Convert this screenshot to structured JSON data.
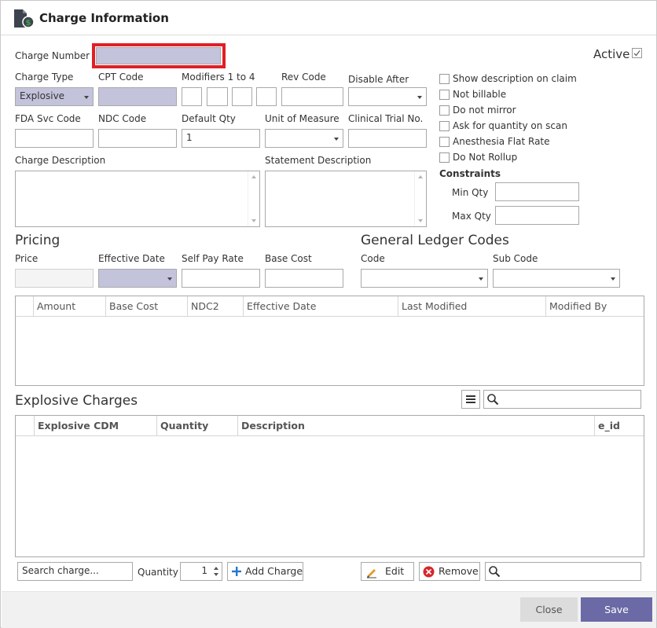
{
  "window": {
    "title": "Charge Information"
  },
  "header": {
    "charge_number_label": "Charge Number",
    "active_label": "Active"
  },
  "fields": {
    "charge_type_label": "Charge Type",
    "charge_type_value": "Explosive",
    "cpt_code_label": "CPT Code",
    "modifiers_label": "Modifiers 1 to 4",
    "rev_code_label": "Rev Code",
    "disable_after_label": "Disable After",
    "fda_svc_label": "FDA Svc Code",
    "ndc_code_label": "NDC Code",
    "default_qty_label": "Default Qty",
    "default_qty_value": "1",
    "uom_label": "Unit of Measure",
    "clinical_trial_label": "Clinical Trial No.",
    "charge_desc_label": "Charge Description",
    "statement_desc_label": "Statement Description"
  },
  "options": {
    "show_desc": "Show description on claim",
    "not_billable": "Not billable",
    "do_not_mirror": "Do not mirror",
    "ask_qty": "Ask for quantity on scan",
    "anesthesia": "Anesthesia Flat Rate",
    "do_not_rollup": "Do Not Rollup",
    "constraints": "Constraints",
    "min_qty": "Min Qty",
    "max_qty": "Max Qty"
  },
  "pricing": {
    "title": "Pricing",
    "price_label": "Price",
    "effective_date_label": "Effective Date",
    "self_pay_label": "Self Pay Rate",
    "base_cost_label": "Base Cost"
  },
  "gl": {
    "title": "General Ledger Codes",
    "code_label": "Code",
    "sub_code_label": "Sub Code"
  },
  "price_grid": {
    "columns": [
      "Amount",
      "Base Cost",
      "NDC2",
      "Effective Date",
      "Last Modified",
      "Modified By"
    ]
  },
  "explosive": {
    "title": "Explosive Charges",
    "columns": [
      "Explosive CDM",
      "Quantity",
      "Description",
      "e_id"
    ],
    "search_placeholder": "Search charge...",
    "quantity_label": "Quantity",
    "quantity_value": "1",
    "add_charge": "Add Charge",
    "edit": "Edit",
    "remove": "Remove"
  },
  "footer": {
    "close": "Close",
    "save": "Save"
  },
  "colors": {
    "accent": "#6b6aa6",
    "lilac_field": "#c4c3dc",
    "highlight": "#e01f26"
  }
}
